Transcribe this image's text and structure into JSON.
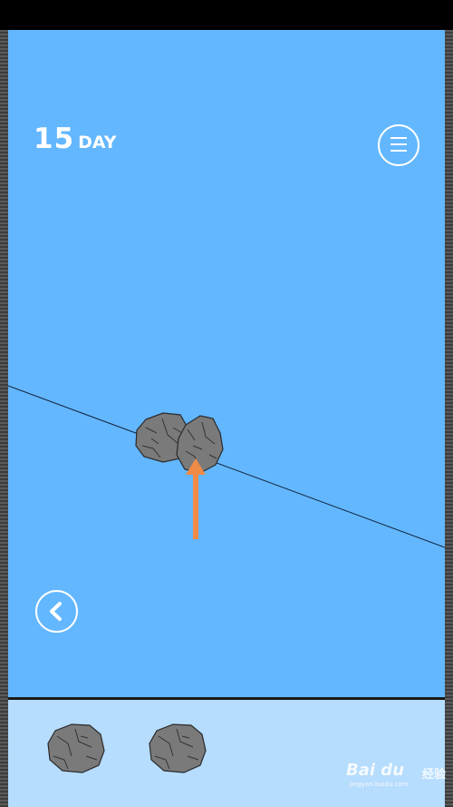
{
  "hud": {
    "day_number": "15",
    "day_label": "DAY"
  },
  "icons": {
    "menu": "hamburger-menu-icon",
    "back": "chevron-left-icon",
    "hint": "orange-up-arrow-icon",
    "rock": "rock-icon"
  },
  "colors": {
    "sky": "#63b7fe",
    "tray": "#b6dcfe",
    "rock": "#7a7a7a",
    "hint_arrow": "#f08a47",
    "ui_white": "#ffffff"
  },
  "scene": {
    "rocks_on_line": 2
  },
  "inventory": {
    "items": [
      {
        "type": "rock"
      },
      {
        "type": "rock"
      }
    ]
  },
  "watermark": {
    "brand": "Bai du",
    "sub": "经验",
    "url": "jingyan.baidu.com"
  }
}
